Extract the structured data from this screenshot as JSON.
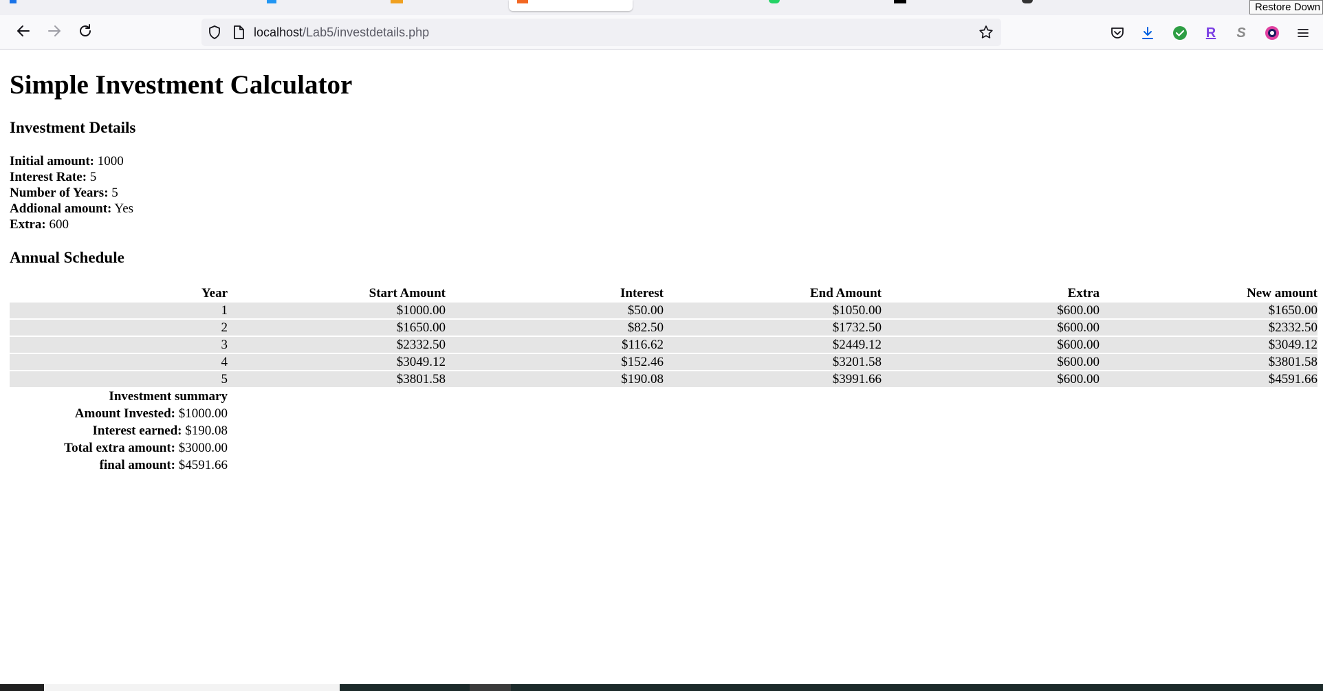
{
  "browser": {
    "tooltip": "Restore Down",
    "url_host": "localhost",
    "url_path": "/Lab5/investdetails.php",
    "colors": {
      "chrome": "#f9f9fb",
      "urlbar": "#f0f0f4",
      "extension_green": "#2e9e44",
      "extension_r": "#7b3fe4"
    },
    "icons": [
      "back-icon",
      "forward-icon",
      "reload-icon",
      "shield-icon",
      "page-icon",
      "star-icon",
      "pocket-icon",
      "download-icon",
      "check-extension-icon",
      "r-extension-icon",
      "s-extension-icon",
      "circle-extension-icon",
      "menu-icon"
    ],
    "ext_r_letter": "R",
    "ext_s_letter": "S"
  },
  "page": {
    "title": "Simple Investment Calculator",
    "details_heading": "Investment Details",
    "details": [
      {
        "label": "Initial amount:",
        "value": "1000"
      },
      {
        "label": "Interest Rate:",
        "value": "5"
      },
      {
        "label": "Number of Years:",
        "value": "5"
      },
      {
        "label": "Addional amount:",
        "value": "Yes"
      },
      {
        "label": "Extra:",
        "value": "600"
      }
    ],
    "schedule_heading": "Annual Schedule",
    "table": {
      "headers": [
        "Year",
        "Start Amount",
        "Interest",
        "End Amount",
        "Extra",
        "New amount"
      ],
      "rows": [
        [
          "1",
          "$1000.00",
          "$50.00",
          "$1050.00",
          "$600.00",
          "$1650.00"
        ],
        [
          "2",
          "$1650.00",
          "$82.50",
          "$1732.50",
          "$600.00",
          "$2332.50"
        ],
        [
          "3",
          "$2332.50",
          "$116.62",
          "$2449.12",
          "$600.00",
          "$3049.12"
        ],
        [
          "4",
          "$3049.12",
          "$152.46",
          "$3201.58",
          "$600.00",
          "$3801.58"
        ],
        [
          "5",
          "$3801.58",
          "$190.08",
          "$3991.66",
          "$600.00",
          "$4591.66"
        ]
      ]
    },
    "summary": {
      "heading": "Investment summary",
      "items": [
        {
          "label": "Amount Invested:",
          "value": "$1000.00"
        },
        {
          "label": "Interest earned:",
          "value": "$190.08"
        },
        {
          "label": "Total extra amount:",
          "value": "$3000.00"
        },
        {
          "label": "final amount:",
          "value": "$4591.66"
        }
      ]
    }
  }
}
